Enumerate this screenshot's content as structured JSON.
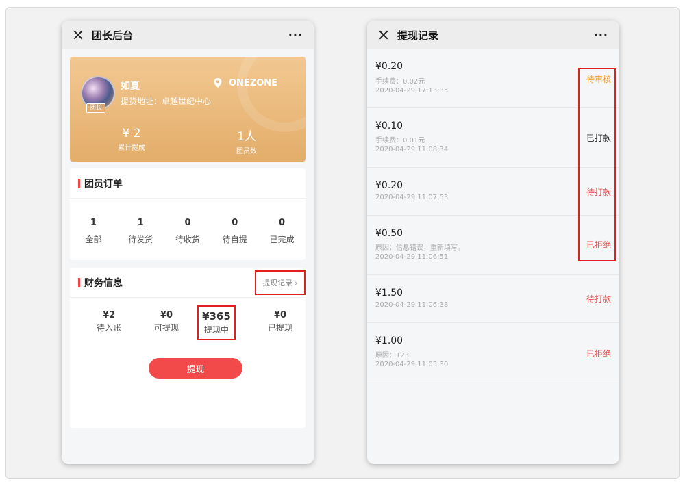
{
  "left_screen": {
    "nav": {
      "title": "团长后台",
      "more": "···"
    },
    "profile": {
      "name": "如夏",
      "role_tag": "团长",
      "location": "ONEZONE",
      "address": "提货地址：卓越世纪中心",
      "stats": [
        {
          "value": "¥ 2",
          "label": "累计提成"
        },
        {
          "value": "1人",
          "label": "团员数"
        }
      ]
    },
    "orders": {
      "title": "团员订单",
      "items": [
        {
          "count": "1",
          "label": "全部"
        },
        {
          "count": "1",
          "label": "待发货"
        },
        {
          "count": "0",
          "label": "待收货"
        },
        {
          "count": "0",
          "label": "待自提"
        },
        {
          "count": "0",
          "label": "已完成"
        }
      ]
    },
    "finance": {
      "title": "财务信息",
      "link_label": "提现记录",
      "items": [
        {
          "value": "¥2",
          "label": "待入账"
        },
        {
          "value": "¥0",
          "label": "可提现"
        },
        {
          "value": "¥365",
          "label": "提现中"
        },
        {
          "value": "¥0",
          "label": "已提现"
        }
      ],
      "button_label": "提现"
    }
  },
  "right_screen": {
    "nav": {
      "title": "提现记录",
      "more": "···"
    },
    "records": [
      {
        "amount": "¥0.20",
        "note": "手续费：0.02元",
        "time": "2020-04-29 17:13:35",
        "status": "待审核"
      },
      {
        "amount": "¥0.10",
        "note": "手续费：0.01元",
        "time": "2020-04-29 11:08:34",
        "status": "已打款"
      },
      {
        "amount": "¥0.20",
        "note": "",
        "time": "2020-04-29 11:07:53",
        "status": "待打款"
      },
      {
        "amount": "¥0.50",
        "note": "原因：信息错误，重新填写。",
        "time": "2020-04-29 11:06:51",
        "status": "已拒绝"
      },
      {
        "amount": "¥1.50",
        "note": "",
        "time": "2020-04-29 11:06:38",
        "status": "待打款"
      },
      {
        "amount": "¥1.00",
        "note": "原因：123",
        "time": "2020-04-29 11:05:30",
        "status": "已拒绝"
      }
    ]
  },
  "colors": {
    "accent_red": "#f24a4a",
    "status_pending_review": "#f39c2a",
    "status_paid": "#333333",
    "status_red": "#e85454",
    "card_gold": "#e3ad6a"
  }
}
